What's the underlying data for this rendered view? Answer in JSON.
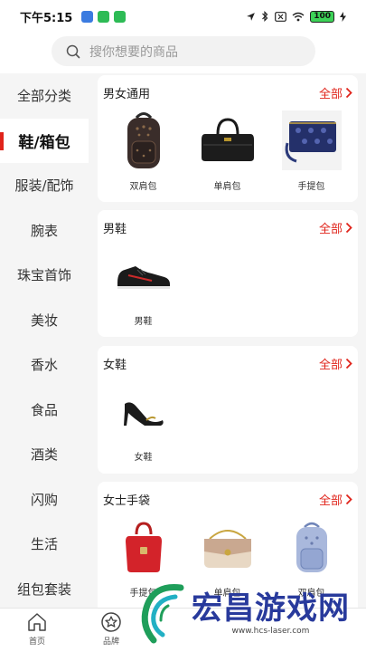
{
  "status_bar": {
    "time": "下午5:15",
    "battery": "100",
    "app_chip_colors": [
      "#3b7be0",
      "#2dbb55",
      "#2dbb55"
    ]
  },
  "search": {
    "placeholder": "搜你想要的商品"
  },
  "sidebar": {
    "items": [
      {
        "label": "全部分类"
      },
      {
        "label": "鞋/箱包",
        "active": true
      },
      {
        "label": "服装/配饰"
      },
      {
        "label": "腕表"
      },
      {
        "label": "珠宝首饰"
      },
      {
        "label": "美妆"
      },
      {
        "label": "香水"
      },
      {
        "label": "食品"
      },
      {
        "label": "酒类"
      },
      {
        "label": "闪购"
      },
      {
        "label": "生活"
      },
      {
        "label": "组包套装"
      }
    ]
  },
  "sections": [
    {
      "title": "男女通用",
      "more": "全部",
      "products": [
        {
          "label": "双肩包",
          "icon": "backpack-icon"
        },
        {
          "label": "单肩包",
          "icon": "duffel-bag-icon"
        },
        {
          "label": "手提包",
          "icon": "wristlet-icon"
        }
      ]
    },
    {
      "title": "男鞋",
      "more": "全部",
      "products": [
        {
          "label": "男鞋",
          "icon": "sneaker-icon"
        }
      ]
    },
    {
      "title": "女鞋",
      "more": "全部",
      "products": [
        {
          "label": "女鞋",
          "icon": "high-heel-icon"
        }
      ]
    },
    {
      "title": "女士手袋",
      "more": "全部",
      "products": [
        {
          "label": "手提包",
          "icon": "red-handbag-icon"
        },
        {
          "label": "单肩包",
          "icon": "shoulder-bag-icon"
        },
        {
          "label": "双肩包",
          "icon": "mini-backpack-icon"
        }
      ]
    }
  ],
  "bottom_nav": {
    "items": [
      {
        "label": "首页",
        "icon": "home-icon"
      },
      {
        "label": "品牌",
        "icon": "star-icon"
      }
    ]
  },
  "watermark": {
    "text": "宏昌游戏网",
    "url": "www.hcs-laser.com"
  },
  "colors": {
    "accent": "#e0241b",
    "sidebar_bg": "#f5f5f5",
    "watermark": "#283a9c"
  }
}
